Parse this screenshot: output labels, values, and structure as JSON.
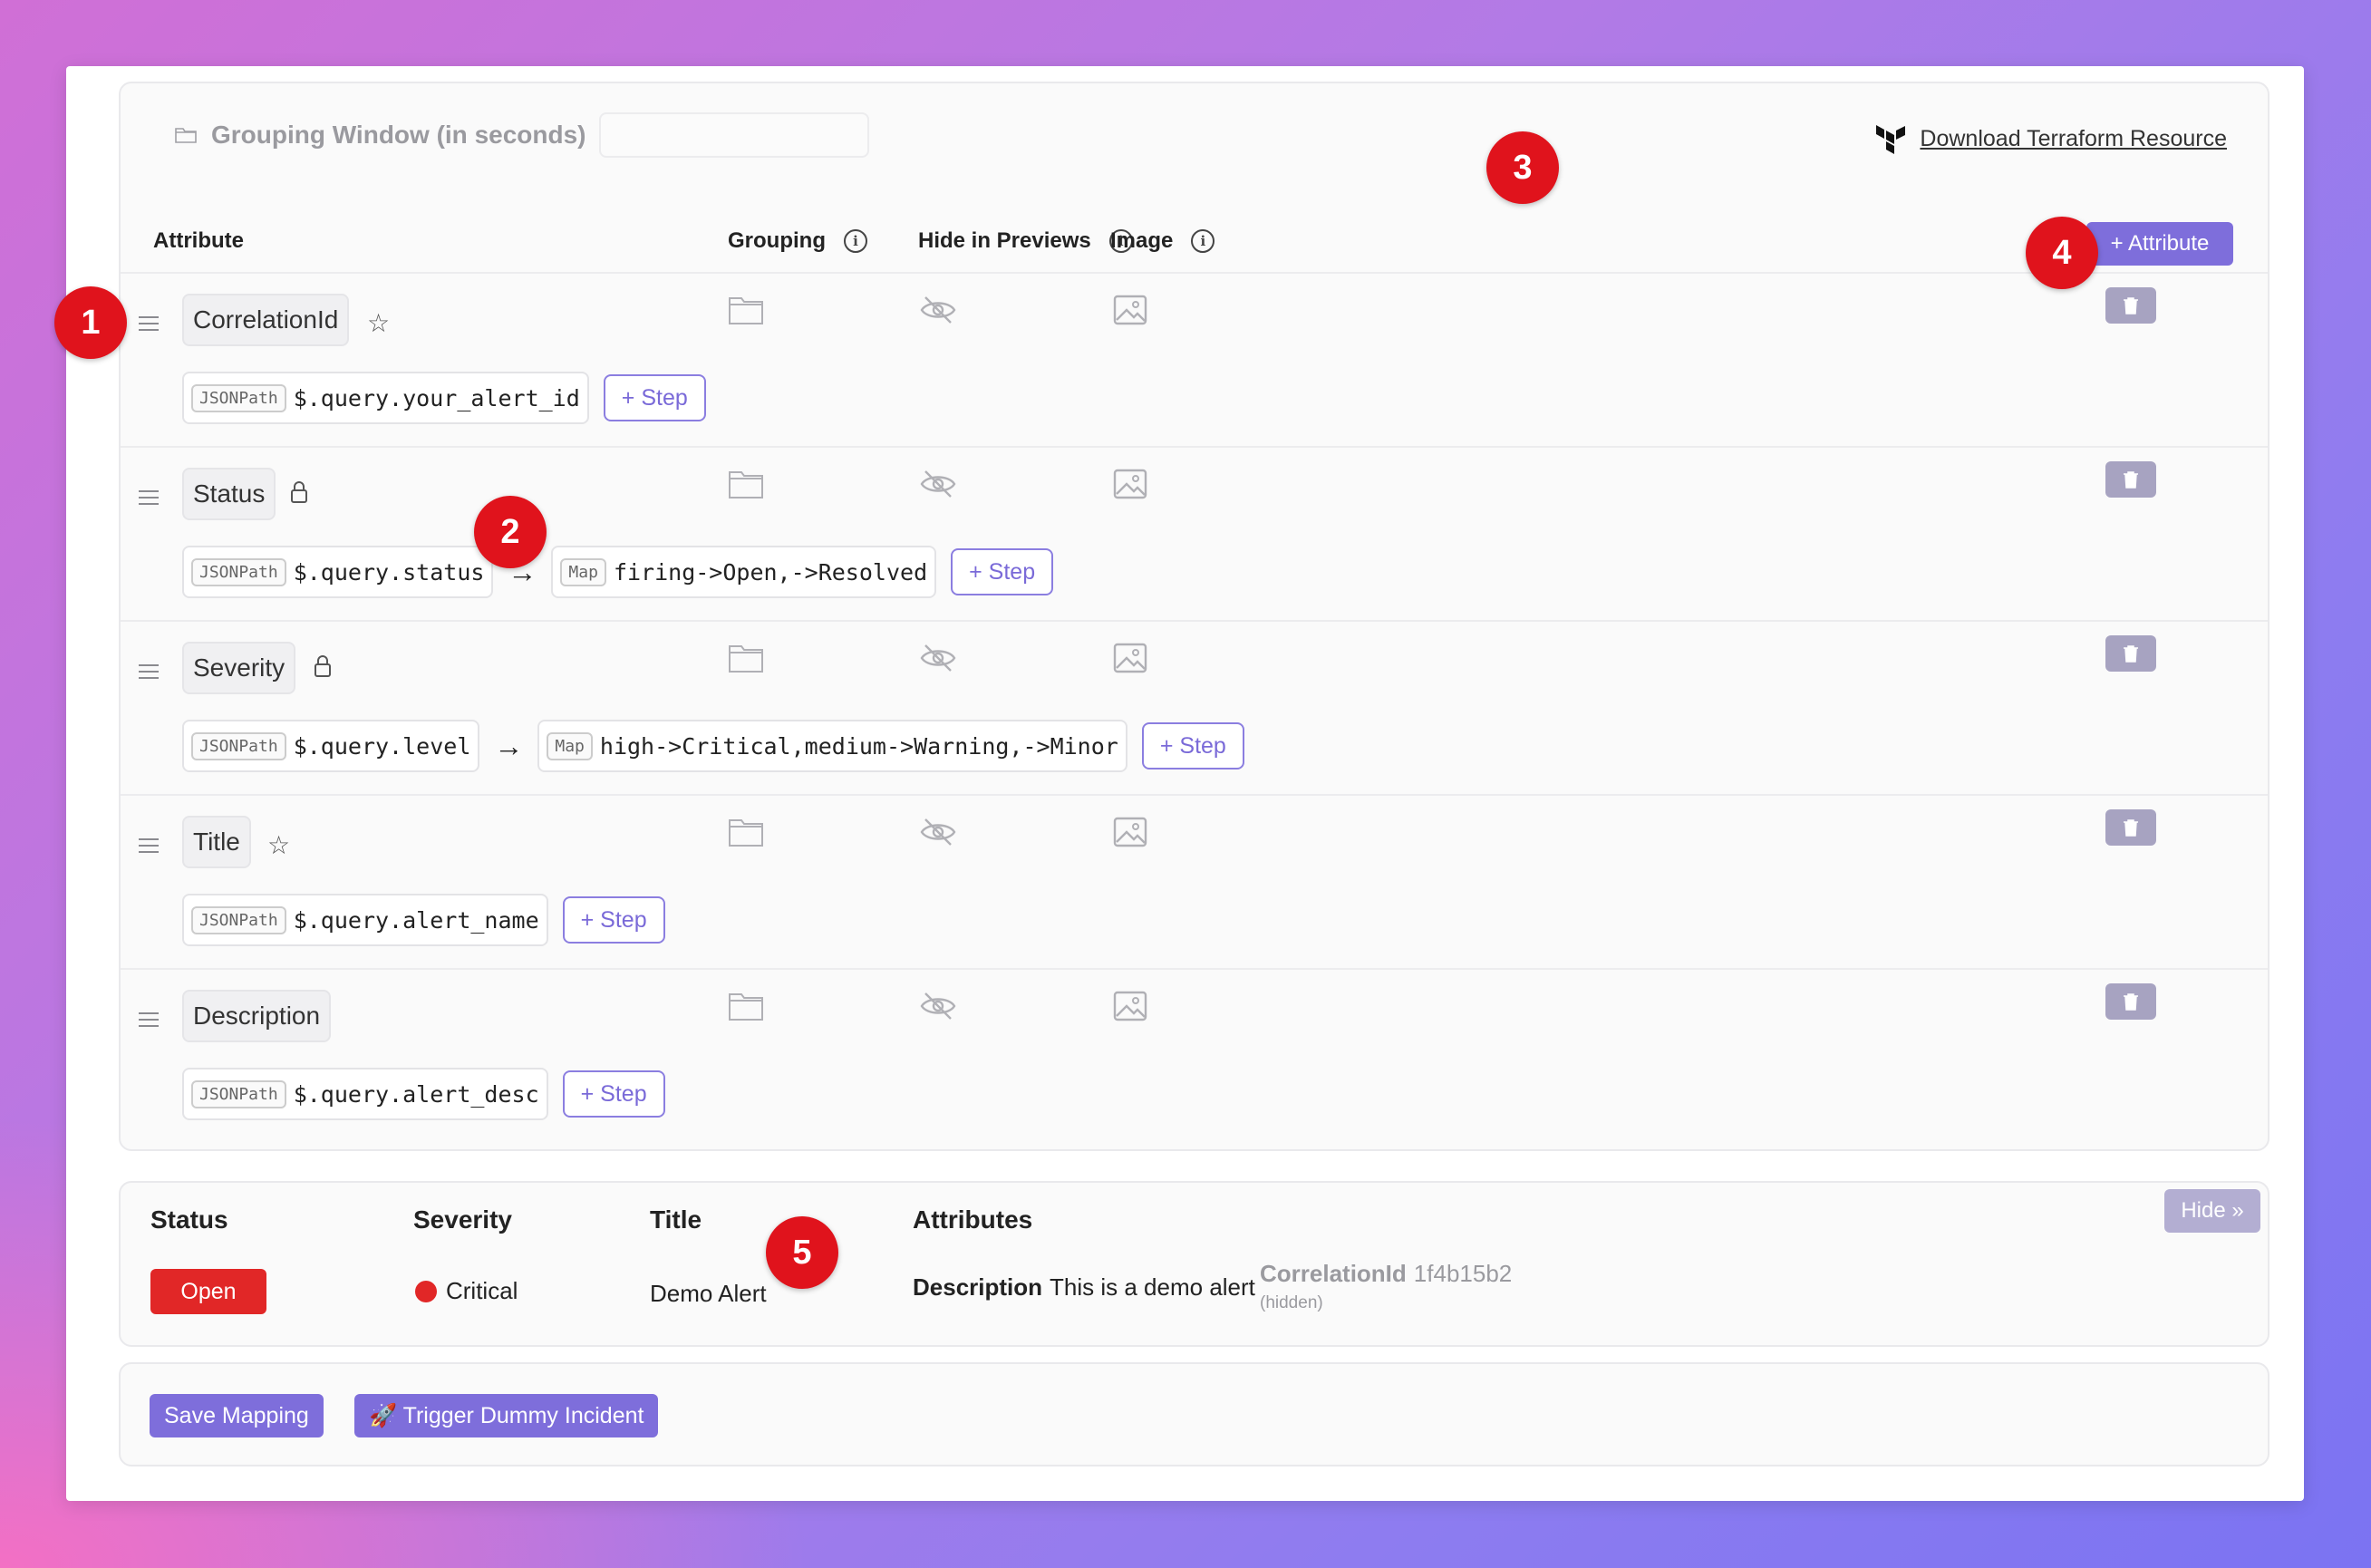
{
  "header": {
    "grouping_window_label": "Grouping Window (in seconds)",
    "grouping_window_value": "",
    "terraform_link": "Download Terraform Resource"
  },
  "columns": {
    "attribute": "Attribute",
    "grouping": "Grouping",
    "hide_in_previews": "Hide in Previews",
    "image": "Image",
    "add_attribute": "+ Attribute"
  },
  "rows": [
    {
      "name": "CorrelationId",
      "badge": "star-icon",
      "steps": [
        {
          "tag": "JSONPath",
          "value": "$.query.your_alert_id"
        }
      ],
      "step_button": "+ Step"
    },
    {
      "name": "Status",
      "badge": "lock-icon",
      "steps": [
        {
          "tag": "JSONPath",
          "value": "$.query.status"
        },
        {
          "tag": "Map",
          "value": "firing->Open,->Resolved"
        }
      ],
      "step_button": "+ Step"
    },
    {
      "name": "Severity",
      "badge": "lock-icon",
      "steps": [
        {
          "tag": "JSONPath",
          "value": "$.query.level"
        },
        {
          "tag": "Map",
          "value": "high->Critical,medium->Warning,->Minor"
        }
      ],
      "step_button": "+ Step"
    },
    {
      "name": "Title",
      "badge": "star-icon",
      "steps": [
        {
          "tag": "JSONPath",
          "value": "$.query.alert_name"
        }
      ],
      "step_button": "+ Step"
    },
    {
      "name": "Description",
      "badge": "",
      "steps": [
        {
          "tag": "JSONPath",
          "value": "$.query.alert_desc"
        }
      ],
      "step_button": "+ Step"
    }
  ],
  "preview": {
    "status_label": "Status",
    "severity_label": "Severity",
    "title_label": "Title",
    "attributes_label": "Attributes",
    "status_value": "Open",
    "severity_value": "Critical",
    "title_value": "Demo Alert",
    "description_key": "Description",
    "description_value": "This is a demo alert",
    "correlation_key": "CorrelationId",
    "correlation_value": "1f4b15b2",
    "hidden_note": "(hidden)",
    "hide_button": "Hide »"
  },
  "actions": {
    "save": "Save Mapping",
    "trigger": "🚀 Trigger Dummy Incident"
  },
  "markers": [
    "1",
    "2",
    "3",
    "4",
    "5"
  ],
  "colors": {
    "accent": "#7e6edb",
    "critical": "#e12727",
    "marker": "#e0131c"
  }
}
